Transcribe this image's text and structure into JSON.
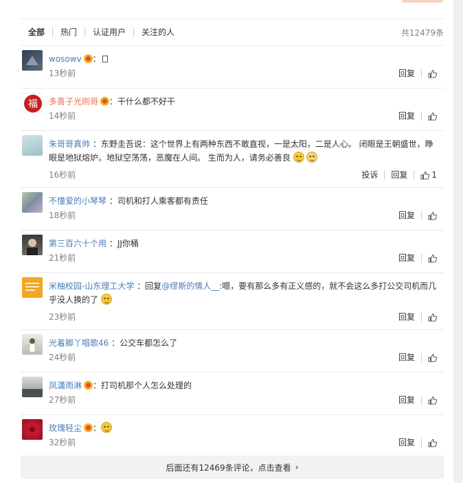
{
  "tabs": [
    {
      "label": "全部",
      "active": true
    },
    {
      "label": "热门",
      "active": false
    },
    {
      "label": "认证用户",
      "active": false
    },
    {
      "label": "关注的人",
      "active": false
    }
  ],
  "total_label": "共12479条",
  "actions": {
    "reply": "回复",
    "report": "投诉"
  },
  "comments": [
    {
      "user": "wosowv",
      "sep": "：",
      "text": "",
      "time": "13秒前",
      "like_count": ""
    },
    {
      "user": "多喜子光刚哥",
      "sep": "：",
      "text": "干什么都不好干",
      "time": "14秒前",
      "like_count": ""
    },
    {
      "user": "朱哥哥真帅",
      "sep": " ：",
      "text": "东野圭吾说：这个世界上有两种东西不敢直视，一是太阳，二是人心。 闭眼是王朝盛世，睁眼是地狱熔炉。地狱空荡荡，恶魔在人间。 生而为人，请务必善良",
      "time": "16秒前",
      "like_count": "1"
    },
    {
      "user": "不懂爱的小琴琴",
      "sep": " ：",
      "text": "司机和打人乘客都有责任",
      "time": "18秒前",
      "like_count": ""
    },
    {
      "user": "第三百六十个用",
      "sep": " ：",
      "text": "JJ你桶",
      "time": "21秒前",
      "like_count": ""
    },
    {
      "user": "米柚校园-山东理工大学",
      "sep": " ：",
      "text_prefix": "回复",
      "mention": "@缪斯的情人__",
      "text": ":嗯，要有那么多有正义感的，就不会这么多打公交司机而几乎没人换的了",
      "time": "23秒前",
      "like_count": ""
    },
    {
      "user": "光着脚丫唱歌46",
      "sep": " ：",
      "text": "公交车都怎么了",
      "time": "24秒前",
      "like_count": ""
    },
    {
      "user": "凤瀟雨淋",
      "sep": "：",
      "text": "打司机那个人怎么处理的",
      "time": "27秒前",
      "like_count": ""
    },
    {
      "user": "玫瑰轻尘",
      "sep": "：",
      "text": "",
      "time": "32秒前",
      "like_count": ""
    }
  ],
  "more_label": "后面还有12469条评论，点击查看",
  "colors": {
    "accent": "#eb7350",
    "link": "#4a7db8",
    "muted": "#808080"
  }
}
